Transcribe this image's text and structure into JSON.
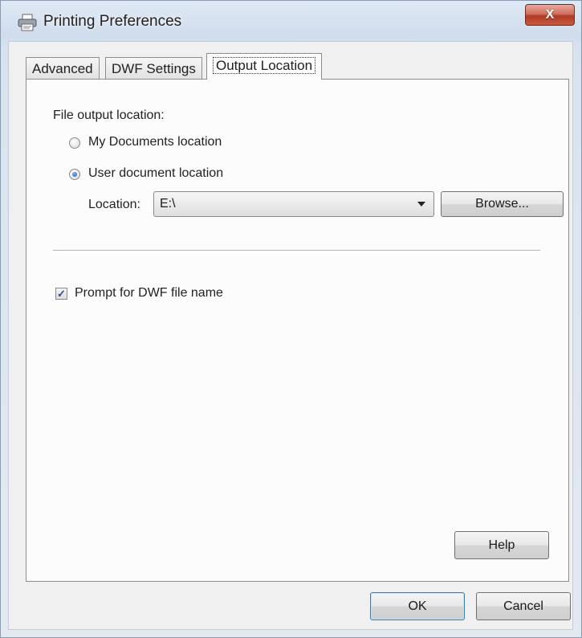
{
  "window": {
    "title": "Printing Preferences",
    "close_label": "X"
  },
  "icons": {
    "app": "printer-icon",
    "close": "close-icon",
    "dropdown": "chevron-down-icon",
    "check": "checkmark-icon"
  },
  "tabs": [
    {
      "label": "Advanced"
    },
    {
      "label": "DWF Settings"
    },
    {
      "label": "Output Location",
      "active": true
    }
  ],
  "output": {
    "group_label": "File output location:",
    "option_my_docs": "My Documents location",
    "option_user_doc": "User document location",
    "selected_option": "User document location",
    "location_label": "Location:",
    "location_value": "E:\\",
    "browse_label": "Browse...",
    "prompt_label": "Prompt for DWF file name",
    "prompt_checked": true,
    "help_label": "Help"
  },
  "footer": {
    "ok_label": "OK",
    "cancel_label": "Cancel"
  },
  "colors": {
    "accent": "#1c5ea9",
    "close_button": "#c55a40"
  }
}
